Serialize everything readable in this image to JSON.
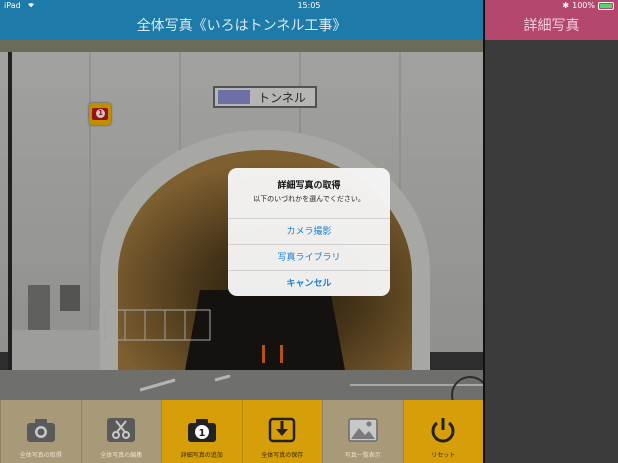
{
  "status_bar": {
    "device": "iPad",
    "time": "15:05",
    "battery": "100%"
  },
  "navbar": {
    "title": "全体写真《いろはトンネル工事》"
  },
  "side_panel": {
    "title": "詳細写真"
  },
  "photo": {
    "sign_text": "トンネル",
    "marker_number": "1"
  },
  "alert": {
    "title": "詳細写真の取得",
    "message": "以下のいづれかを選んでください。",
    "buttons": [
      "カメラ撮影",
      "写真ライブラリ",
      "キャンセル"
    ]
  },
  "toolbar": {
    "items": [
      {
        "label": "全体写真の取得",
        "icon": "camera-icon",
        "enabled": false
      },
      {
        "label": "全体写真の編集",
        "icon": "scissors-icon",
        "enabled": false
      },
      {
        "label": "詳細写真の追加",
        "icon": "numbered-camera-icon",
        "enabled": true,
        "badge": "1"
      },
      {
        "label": "全体写真の保存",
        "icon": "download-icon",
        "enabled": true
      },
      {
        "label": "写真一覧表示",
        "icon": "image-icon",
        "enabled": false
      },
      {
        "label": "リセット",
        "icon": "power-icon",
        "enabled": true
      }
    ]
  },
  "colors": {
    "navbar": "#1e7aa8",
    "side_navbar": "#b3476e",
    "toolbar_active": "#d69e08",
    "alert_button": "#1a7fd4"
  }
}
